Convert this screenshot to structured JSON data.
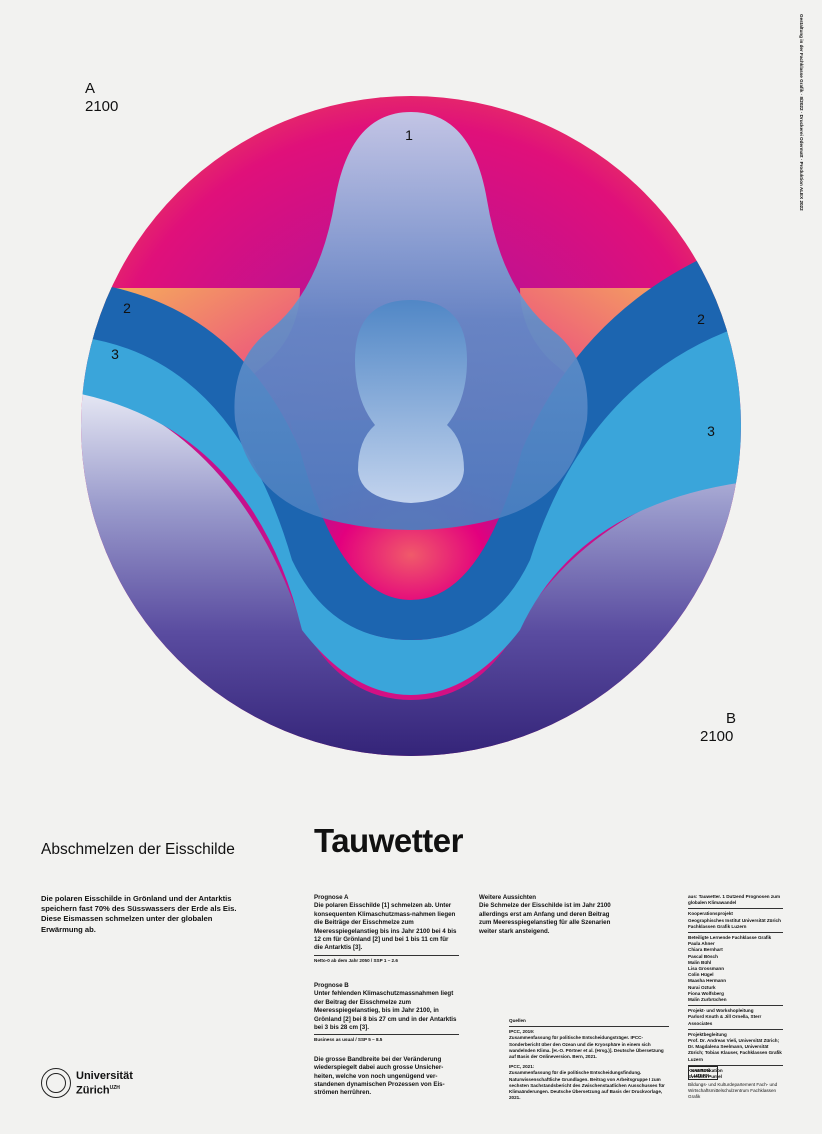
{
  "figure": {
    "label_a": "A",
    "label_a_year": "2100",
    "label_b": "B",
    "label_b_year": "2100",
    "markers": [
      "1",
      "2",
      "3",
      "2",
      "3"
    ],
    "colors": {
      "magenta": "#e4007d",
      "orange": "#f08a30",
      "dark_blue": "#1c65b0",
      "light_blue": "#3aa5da",
      "navy": "#2c1e72",
      "ice": "#bcd3ee"
    }
  },
  "title": "Tauwetter",
  "subtitle": "Abschmelzen der Eisschilde",
  "intro": "Die polaren Eisschilde in Grönland und der Antarktis speichern fast 70% des Süsswassers der Erde als Eis. Diese Eismassen schmelzen unter der globalen Erwärmung ab.",
  "prognose_a": {
    "heading": "Prognose A",
    "body": "Die polaren Eisschilde [1] schmelzen ab. Unter konsequenten Klimaschutzmass-nahmen liegen die Beiträge der Eisschmelze zum Meeresspiegelanstieg bis ins Jahr 2100 bei 4 bis 12 cm für Grönland [2] und bei 1 bis 11 cm für die Antarktis [3].",
    "note": "Netto-0 ab dem Jahr 2050 / SSP 1 – 2.6"
  },
  "prognose_b": {
    "heading": "Prognose B",
    "body": "Unter fehlenden Klimaschutzmassnahmen liegt der Beitrag der Eisschmelze zum Meeresspiegelanstieg, bis im Jahr 2100, in Grönland [2] bei 8 bis 27 cm und in der Antarktis bei 3 bis 28 cm [3].",
    "note": "Business as usual / SSP 5 – 8.5",
    "closing": "Die grosse Bandbreite bei der Veränderung wiederspiegelt dabei auch grosse Unsicher-heiten, welche von noch ungenügend ver-standenen dynamischen Prozessen von Eis-strömen herrühren."
  },
  "weitere": {
    "heading": "Weitere Aussichten",
    "body": "Die Schmelze der Eisschilde ist im Jahr 2100 allerdings erst am Anfang und deren Beitrag zum Meeresspiegelanstieg für alle Szenarien weiter stark ansteigend."
  },
  "sources": {
    "heading": "Quellen",
    "item1_title": "IPCC, 2019:",
    "item1": "Zusammenfassung für politische Entscheidungsträger. IPCC-Sonderbericht über den Ozean und die Kryosphäre in einem sich wandelnden Klima. [H.-O. Pörtner et al. (Hrsg.)]. Deutsche Übersetzung auf Basis der Onlineversion. Bern, 2021.",
    "item2_title": "IPCC, 2021:",
    "item2": "Zusammenfassung für die politische Entscheidungsfindung. Naturwissenschaftliche Grundlagen. Beitrag von Arbeitsgruppe I zum sechsten Sachstandsbericht des Zwischenstaatlichen Ausschusses für Klimaänderungen. Deutsche Übersetzung auf Basis der Druckvorlage, 2021."
  },
  "credits": {
    "series": "aus: Tauwetter. 1 Dutzend Prognosen zum globalen Klimawandel",
    "partner_heading": "Kooperationsprojekt",
    "partner": "Geographisches Institut Universität Zürich Fachklassen Grafik Luzern",
    "team_heading": "Beteiligte Lernende Fachklasse Grafik",
    "team": [
      "Paula Ahner",
      "Chiara Bernhart",
      "Pascal Bösch",
      "Malin Bühl",
      "Lisa Grossmann",
      "Colin Hügel",
      "Maasha Hermann",
      "Nurai Ozturk",
      "Fiona Wolfsberg",
      "Malin Zurbrüchen"
    ],
    "project_heading": "Projekt- und Workshopleitung",
    "project": "Parlord Knuth & Jill Ornella, Sterr Associates",
    "lead_heading": "Projektbegleitung",
    "lead": "Prof. Dr. Andreas Vieli, Universität Zürich; Dr. Magdalena Seelmann, Universität Zürich; Tobias Klauser, Fachklassen Grafik Luzern",
    "comm_heading": "Kommunikation",
    "comm": "Svetlana Pumel",
    "luzern_logo": "KANTON LUZERN",
    "luzern_text": "Bildungs- und Kulturdepartement Fach- und Wirtschaftsmittelschulzentrum Fachklassen Grafik"
  },
  "vertical_text": "Gestaltung in der Fachklasse Grafik · 8/2022 · Druckerei Odermatt · Produktion ALEX 2022",
  "university": {
    "name_line1": "Universität",
    "name_line2": "Zürich",
    "sup": "UZH"
  }
}
